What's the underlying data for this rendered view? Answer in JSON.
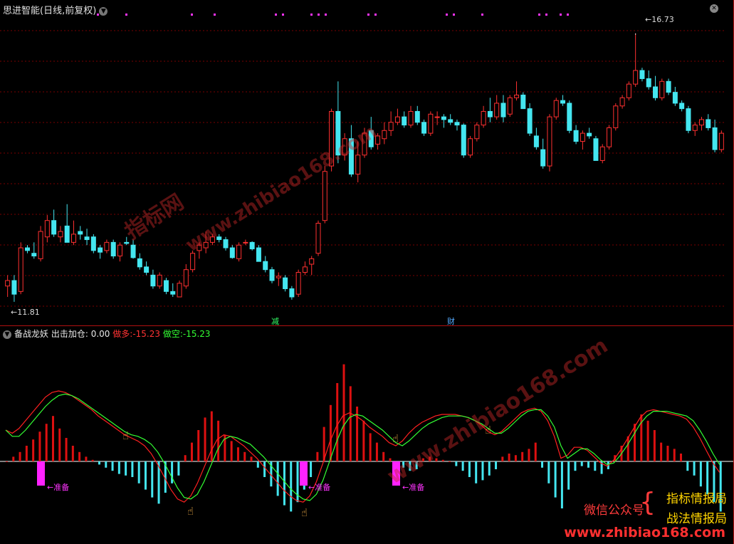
{
  "main_chart": {
    "title": "思进智能(日线,前复权)",
    "collapse_icon": "chevron-down-icon",
    "close_icon": "close-icon",
    "high_label": "16.73",
    "low_label": "11.81",
    "event_marks": [
      {
        "text": "减",
        "color": "#33ff66"
      },
      {
        "text": "财",
        "color": "#55aaff"
      }
    ],
    "colors": {
      "up": "#ff3030",
      "down": "#44e6f0",
      "grid": "#7a0000",
      "magenta": "#ff33ff"
    }
  },
  "indicator": {
    "name": "备战龙妖",
    "label1": "出击加仓:",
    "value1": "0.00",
    "label2": "做多:",
    "value2": "-15.23",
    "label3": "做空:",
    "value3": "-15.23",
    "prepare_label": "准备",
    "hand_icon": "pointing-hand-icon"
  },
  "watermark": {
    "cn": "指标网",
    "url1": "www.zhibiao168.com",
    "url2": "www.zhibiao168.com",
    "site": "www.zhibiao168.com"
  },
  "branding": {
    "left": "微信公众号",
    "right1": "指标情报局",
    "right2": "战法情报局"
  },
  "chart_data": {
    "type": "candlestick",
    "candles": [
      [
        12.1,
        12.3,
        11.9,
        12.2
      ],
      [
        12.2,
        12.3,
        11.81,
        11.95
      ],
      [
        12.0,
        12.9,
        11.95,
        12.8
      ],
      [
        12.8,
        12.85,
        12.7,
        12.75
      ],
      [
        12.7,
        12.9,
        12.6,
        12.65
      ],
      [
        12.6,
        13.2,
        12.55,
        13.1
      ],
      [
        13.0,
        13.4,
        12.9,
        13.3
      ],
      [
        13.3,
        13.5,
        13.0,
        13.05
      ],
      [
        13.0,
        13.2,
        12.9,
        13.1
      ],
      [
        13.2,
        13.6,
        12.9,
        12.9
      ],
      [
        12.9,
        13.3,
        12.85,
        13.05
      ],
      [
        13.1,
        13.2,
        12.95,
        13.05
      ],
      [
        13.0,
        13.15,
        12.85,
        12.95
      ],
      [
        13.0,
        13.05,
        12.7,
        12.75
      ],
      [
        12.8,
        12.85,
        12.6,
        12.72
      ],
      [
        12.75,
        12.95,
        12.7,
        12.9
      ],
      [
        12.9,
        12.95,
        12.6,
        12.65
      ],
      [
        12.65,
        12.9,
        12.55,
        12.85
      ],
      [
        12.9,
        13.0,
        12.85,
        12.88
      ],
      [
        12.85,
        12.95,
        12.6,
        12.62
      ],
      [
        12.6,
        12.7,
        12.4,
        12.45
      ],
      [
        12.45,
        12.55,
        12.3,
        12.35
      ],
      [
        12.3,
        12.4,
        12.05,
        12.1
      ],
      [
        12.1,
        12.35,
        12.05,
        12.3
      ],
      [
        12.2,
        12.25,
        11.95,
        12.0
      ],
      [
        12.0,
        12.15,
        11.9,
        11.95
      ],
      [
        11.9,
        12.2,
        11.9,
        12.15
      ],
      [
        12.1,
        12.5,
        12.05,
        12.4
      ],
      [
        12.4,
        12.75,
        12.35,
        12.7
      ],
      [
        12.75,
        12.9,
        12.6,
        12.85
      ],
      [
        12.8,
        13.1,
        12.7,
        12.9
      ],
      [
        12.9,
        13.05,
        12.85,
        13.0
      ],
      [
        13.0,
        13.05,
        12.9,
        12.95
      ],
      [
        12.95,
        13.0,
        12.75,
        12.8
      ],
      [
        12.8,
        12.85,
        12.6,
        12.62
      ],
      [
        12.6,
        12.9,
        12.55,
        12.85
      ],
      [
        12.9,
        12.95,
        12.85,
        12.9
      ],
      [
        12.9,
        12.92,
        12.75,
        12.78
      ],
      [
        12.8,
        12.85,
        12.55,
        12.55
      ],
      [
        12.55,
        12.65,
        12.35,
        12.4
      ],
      [
        12.4,
        12.45,
        12.15,
        12.2
      ],
      [
        12.25,
        12.35,
        12.1,
        12.28
      ],
      [
        12.25,
        12.3,
        12.0,
        12.05
      ],
      [
        12.05,
        12.1,
        11.85,
        11.9
      ],
      [
        11.95,
        12.4,
        11.9,
        12.35
      ],
      [
        12.35,
        12.55,
        12.3,
        12.45
      ],
      [
        12.5,
        12.65,
        12.3,
        12.6
      ],
      [
        12.7,
        13.3,
        12.65,
        13.25
      ],
      [
        13.3,
        14.3,
        13.25,
        14.2
      ],
      [
        14.3,
        15.35,
        14.2,
        15.3
      ],
      [
        15.3,
        15.85,
        14.35,
        14.5
      ],
      [
        14.5,
        14.9,
        14.4,
        14.8
      ],
      [
        14.8,
        15.05,
        14.1,
        14.15
      ],
      [
        14.15,
        14.75,
        14.0,
        14.5
      ],
      [
        14.5,
        15.0,
        14.45,
        14.9
      ],
      [
        14.95,
        15.2,
        14.6,
        14.65
      ],
      [
        14.7,
        14.9,
        14.6,
        14.85
      ],
      [
        14.8,
        15.1,
        14.7,
        14.95
      ],
      [
        14.95,
        15.3,
        14.85,
        15.1
      ],
      [
        15.1,
        15.35,
        15.05,
        15.2
      ],
      [
        15.2,
        15.3,
        15.0,
        15.05
      ],
      [
        15.05,
        15.4,
        15.0,
        15.3
      ],
      [
        15.3,
        15.4,
        15.05,
        15.1
      ],
      [
        15.1,
        15.15,
        14.85,
        14.9
      ],
      [
        14.9,
        15.3,
        14.85,
        15.25
      ],
      [
        15.2,
        15.3,
        15.05,
        15.2
      ],
      [
        15.2,
        15.25,
        15.0,
        15.15
      ],
      [
        15.15,
        15.25,
        15.05,
        15.1
      ],
      [
        15.1,
        15.15,
        14.95,
        15.05
      ],
      [
        15.05,
        15.08,
        14.45,
        14.5
      ],
      [
        14.5,
        14.85,
        14.45,
        14.8
      ],
      [
        14.8,
        15.1,
        14.75,
        15.05
      ],
      [
        15.05,
        15.4,
        15.0,
        15.3
      ],
      [
        15.3,
        15.55,
        15.1,
        15.2
      ],
      [
        15.2,
        15.6,
        15.15,
        15.45
      ],
      [
        15.45,
        15.6,
        15.1,
        15.2
      ],
      [
        15.25,
        15.6,
        15.2,
        15.55
      ],
      [
        15.55,
        15.85,
        15.5,
        15.6
      ],
      [
        15.6,
        15.65,
        15.35,
        15.35
      ],
      [
        15.35,
        15.45,
        14.85,
        14.9
      ],
      [
        14.85,
        15.0,
        14.6,
        14.65
      ],
      [
        14.6,
        14.8,
        14.25,
        14.3
      ],
      [
        14.3,
        15.25,
        14.2,
        15.2
      ],
      [
        15.2,
        15.55,
        15.15,
        15.5
      ],
      [
        15.5,
        15.6,
        15.4,
        15.45
      ],
      [
        15.45,
        15.5,
        14.9,
        14.95
      ],
      [
        14.95,
        15.05,
        14.7,
        14.75
      ],
      [
        14.75,
        14.95,
        14.6,
        14.9
      ],
      [
        14.9,
        15.0,
        14.8,
        14.85
      ],
      [
        14.8,
        14.85,
        14.4,
        14.4
      ],
      [
        14.4,
        14.7,
        14.35,
        14.65
      ],
      [
        14.65,
        15.05,
        14.6,
        15.0
      ],
      [
        15.0,
        15.45,
        14.95,
        15.4
      ],
      [
        15.4,
        15.6,
        15.35,
        15.55
      ],
      [
        15.55,
        15.85,
        15.5,
        15.8
      ],
      [
        15.8,
        16.73,
        15.75,
        16.05
      ],
      [
        16.05,
        16.1,
        15.85,
        15.9
      ],
      [
        15.9,
        16.05,
        15.7,
        15.75
      ],
      [
        15.75,
        15.95,
        15.5,
        15.55
      ],
      [
        15.55,
        15.9,
        15.5,
        15.85
      ],
      [
        15.85,
        15.9,
        15.6,
        15.65
      ],
      [
        15.65,
        15.75,
        15.4,
        15.45
      ],
      [
        15.45,
        15.5,
        15.3,
        15.35
      ],
      [
        15.35,
        15.4,
        14.9,
        14.95
      ],
      [
        14.95,
        15.1,
        14.85,
        15.05
      ],
      [
        15.05,
        15.2,
        14.95,
        15.15
      ],
      [
        15.15,
        15.25,
        14.95,
        15.0
      ],
      [
        15.0,
        15.15,
        14.55,
        14.6
      ],
      [
        14.6,
        14.95,
        14.55,
        14.9
      ]
    ],
    "macd_hist": [
      0,
      0.3,
      0.6,
      1.0,
      1.4,
      1.9,
      2.4,
      2.9,
      2.1,
      1.5,
      1.0,
      0.6,
      0.3,
      0.1,
      -0.2,
      -0.4,
      -0.6,
      -0.8,
      -0.9,
      -1.0,
      -1.4,
      -1.8,
      -2.3,
      -2.7,
      -2.0,
      -1.4,
      -0.9,
      0.4,
      1.2,
      2.0,
      2.8,
      3.2,
      2.6,
      1.7,
      1.3,
      0.9,
      0.6,
      0.3,
      -0.4,
      -1.0,
      -1.6,
      -2.2,
      -2.8,
      -3.2,
      -2.6,
      -1.8,
      -1.0,
      0.6,
      2.2,
      3.6,
      5.0,
      6.2,
      4.8,
      3.5,
      2.6,
      1.8,
      1.2,
      0.6,
      0.2,
      -0.2,
      -0.4,
      -0.6,
      -0.5,
      0.2,
      0.3,
      0.2,
      0.1,
      0.0,
      -0.3,
      -0.6,
      -1.0,
      -1.4,
      -1.2,
      -0.9,
      -0.5,
      0.3,
      0.5,
      0.4,
      0.6,
      0.8,
      1.2,
      -0.4,
      -1.4,
      -2.3,
      -3.0,
      -1.8,
      -0.6,
      -0.3,
      -0.4,
      -0.6,
      -0.8,
      -0.5,
      0.4,
      1.0,
      1.6,
      2.4,
      3.0,
      2.6,
      2.0,
      1.2,
      1.0,
      0.8,
      0.5,
      -0.6,
      -0.9,
      -1.6,
      -2.1,
      -2.6,
      -3.2
    ],
    "ma_red": [
      2.0,
      1.8,
      2.1,
      2.6,
      3.1,
      3.6,
      4.1,
      4.4,
      4.5,
      4.4,
      4.2,
      3.9,
      3.6,
      3.3,
      2.9,
      2.6,
      2.3,
      2.0,
      1.7,
      1.5,
      1.3,
      1.0,
      0.5,
      -0.2,
      -1.0,
      -1.8,
      -2.4,
      -2.6,
      -2.2,
      -1.4,
      -0.4,
      0.6,
      1.4,
      1.7,
      1.6,
      1.3,
      1.0,
      0.6,
      0.2,
      -0.3,
      -0.8,
      -1.3,
      -1.8,
      -2.2,
      -2.5,
      -2.6,
      -2.2,
      -1.3,
      -0.1,
      1.2,
      2.2,
      2.9,
      3.1,
      2.9,
      2.6,
      2.2,
      1.9,
      1.6,
      1.2,
      1.0,
      1.3,
      1.8,
      2.2,
      2.5,
      2.7,
      2.9,
      3.0,
      3.0,
      3.0,
      2.9,
      2.8,
      2.6,
      2.3,
      1.9,
      1.7,
      1.9,
      2.3,
      2.7,
      3.1,
      3.3,
      3.4,
      3.2,
      2.6,
      1.6,
      0.2,
      0.4,
      0.9,
      0.9,
      0.7,
      0.3,
      -0.1,
      -0.3,
      0.1,
      0.7,
      1.4,
      2.1,
      2.8,
      3.2,
      3.3,
      3.2,
      3.1,
      3.0,
      2.9,
      2.7,
      2.2,
      1.5,
      0.7,
      -0.1,
      -0.7
    ],
    "ma_green": [
      2.0,
      1.6,
      1.6,
      2.0,
      2.5,
      3.0,
      3.5,
      3.9,
      4.2,
      4.3,
      4.2,
      4.0,
      3.7,
      3.4,
      3.1,
      2.8,
      2.5,
      2.2,
      1.9,
      1.7,
      1.6,
      1.4,
      1.1,
      0.6,
      -0.1,
      -0.9,
      -1.7,
      -2.3,
      -2.4,
      -2.1,
      -1.3,
      -0.3,
      0.7,
      1.4,
      1.6,
      1.5,
      1.3,
      1.1,
      0.7,
      0.3,
      -0.2,
      -0.7,
      -1.2,
      -1.7,
      -2.1,
      -2.4,
      -2.5,
      -2.1,
      -1.2,
      0.0,
      1.2,
      2.2,
      2.8,
      3.0,
      2.9,
      2.6,
      2.3,
      2.0,
      1.6,
      1.2,
      1.0,
      1.3,
      1.7,
      2.1,
      2.4,
      2.6,
      2.8,
      2.9,
      2.9,
      2.9,
      2.8,
      2.6,
      2.4,
      2.1,
      1.8,
      1.8,
      2.1,
      2.5,
      2.9,
      3.2,
      3.3,
      3.3,
      2.9,
      2.2,
      1.0,
      0.2,
      0.5,
      0.8,
      0.8,
      0.5,
      0.1,
      -0.2,
      -0.1,
      0.4,
      1.0,
      1.7,
      2.4,
      2.9,
      3.2,
      3.2,
      3.2,
      3.1,
      3.0,
      2.9,
      2.6,
      2.0,
      1.3,
      0.5,
      -0.2
    ]
  }
}
